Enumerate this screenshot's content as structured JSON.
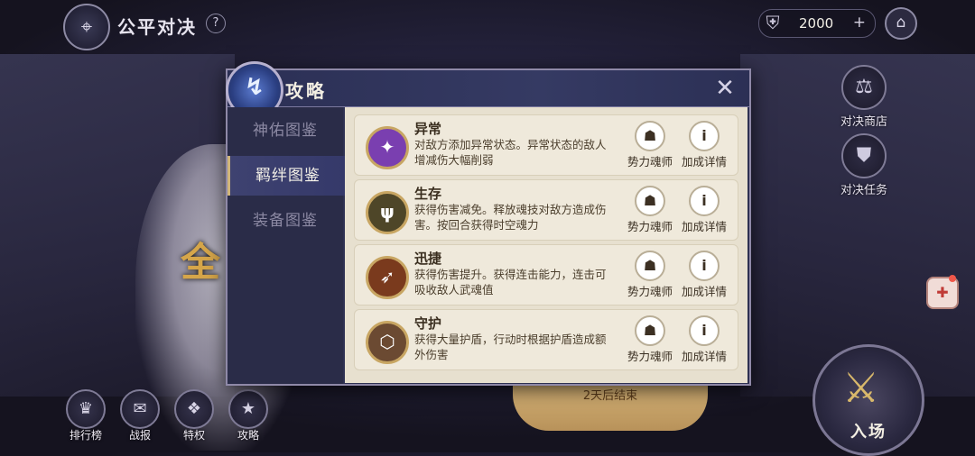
{
  "topbar": {
    "title": "公平对决",
    "help": "?",
    "currency_value": "2000",
    "currency_plus": "+",
    "home_icon": "home-icon"
  },
  "side_menu": [
    {
      "label": "对决商店",
      "icon": "scale-icon"
    },
    {
      "label": "对决任务",
      "icon": "shield-icon"
    }
  ],
  "bottom_menu": [
    {
      "label": "排行榜",
      "icon": "trophy-icon"
    },
    {
      "label": "战报",
      "icon": "report-icon"
    },
    {
      "label": "特权",
      "icon": "privilege-icon"
    },
    {
      "label": "攻略",
      "icon": "guide-icon"
    }
  ],
  "enter_button": {
    "label": "入场"
  },
  "background": {
    "banner_text": "2天后结束",
    "figure_char": "全"
  },
  "modal": {
    "title": "攻略",
    "tabs": [
      {
        "label": "神佑图鉴",
        "active": false
      },
      {
        "label": "羁绊图鉴",
        "active": true
      },
      {
        "label": "装备图鉴",
        "active": false
      }
    ],
    "entries": [
      {
        "name": "异常",
        "desc": "对敌方添加异常状态。异常状态的敌人增减伤大幅削弱",
        "emblem_color": "#7a3fb0",
        "btn1": "势力魂师",
        "btn2": "加成详情"
      },
      {
        "name": "生存",
        "desc": "获得伤害减免。释放魂技对敌方造成伤害。按回合获得时空魂力",
        "emblem_color": "#4e4628",
        "btn1": "势力魂师",
        "btn2": "加成详情"
      },
      {
        "name": "迅捷",
        "desc": "获得伤害提升。获得连击能力，连击可吸收敌人武魂值",
        "emblem_color": "#7a3a1d",
        "btn1": "势力魂师",
        "btn2": "加成详情"
      },
      {
        "name": "守护",
        "desc": "获得大量护盾，行动时根据护盾造成额外伤害",
        "emblem_color": "#6b4a32",
        "btn1": "势力魂师",
        "btn2": "加成详情"
      }
    ]
  }
}
